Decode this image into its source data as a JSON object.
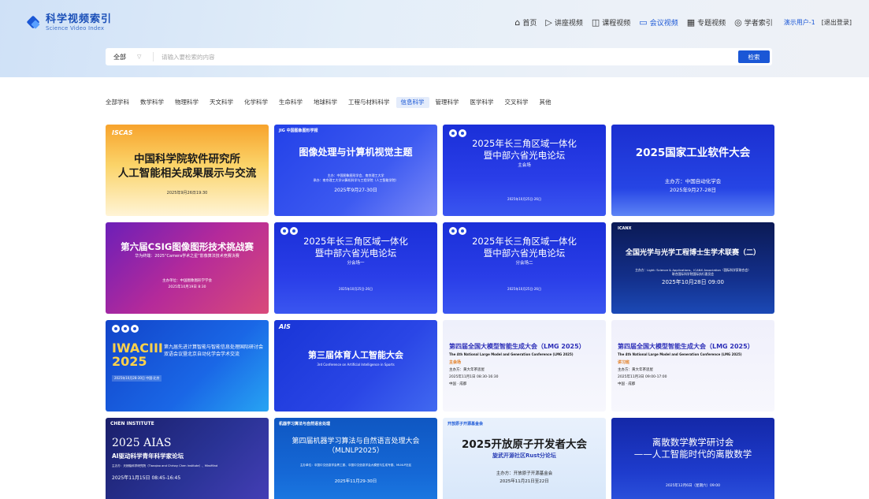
{
  "brand": {
    "name_cn": "科学视频索引",
    "name_en": "Science Video Index",
    "accent": "#1a57d6"
  },
  "nav": {
    "items": [
      {
        "label": "首页",
        "icon": "home-icon"
      },
      {
        "label": "讲座视频",
        "icon": "play-icon"
      },
      {
        "label": "课程视频",
        "icon": "book-icon"
      },
      {
        "label": "会议视频",
        "icon": "monitor-icon",
        "active": true
      },
      {
        "label": "专题视频",
        "icon": "grid-icon"
      },
      {
        "label": "学者索引",
        "icon": "scholar-icon"
      }
    ],
    "user": "演示用户-1",
    "logout": "[退出登录]"
  },
  "search": {
    "scope": "全部",
    "placeholder": "请输入要检索的内容",
    "button": "检索"
  },
  "categories": {
    "items": [
      "全部学科",
      "数学科学",
      "物理科学",
      "天文科学",
      "化学科学",
      "生命科学",
      "地球科学",
      "工程与材料科学",
      "信息科学",
      "管理科学",
      "医学科学",
      "交叉科学",
      "其他"
    ],
    "active": "信息科学"
  },
  "cards": [
    {
      "title": "中国科学院软件研究所\n人工智能相关成果展示与交流",
      "date": "2025年9月26日19:30",
      "tag": "ISCAS"
    },
    {
      "title": "图像处理与计算机视觉主题",
      "org": "主办：中国图象图形学会、南京理工大学\n承办：南京理工大学计算机科学与工程学院（人工智能学院）",
      "date": "2025年9月27-30日",
      "tag": "JIG 中国图象图形学报"
    },
    {
      "title": "2025年长三角区域一体化\n暨中部六省光电论坛",
      "sub": "主会场",
      "date": "2025年10月25日-26日"
    },
    {
      "title": "2025国家工业软件大会",
      "org": "主办方：中国自动化学会",
      "date": "2025年9月27-28日"
    },
    {
      "title": "第六届CSIG图像图形技术挑战赛",
      "sub": "华为终端：2025“Camera学术之星”影像算法技术竞赛决赛",
      "org": "主办单位：中国图象图形学学会",
      "date": "2025年10月19日 8:30"
    },
    {
      "title": "2025年长三角区域一体化\n暨中部六省光电论坛",
      "sub": "分会场一",
      "date": "2025年10月25日-26日"
    },
    {
      "title": "2025年长三角区域一体化\n暨中部六省光电论坛",
      "sub": "分会场二",
      "date": "2025年10月25日-26日"
    },
    {
      "title": "全国光学与光学工程博士生学术联赛（二）",
      "org": "主办方：Light: Science & Applications、ICANX Association（国际科学家联合会）\n联合国际科学院国际执行委员会",
      "date": "2025年10月28日 09:00",
      "tag": "ICANX"
    },
    {
      "title": "IWACIII 2025",
      "sub": "第九届先进计算智能与智能信息处理国际研讨会\n双语会议暨北京自动化学会学术交流",
      "date": "2025年10月28-30日   中国·北京"
    },
    {
      "title": "第三届体育人工智能大会",
      "sub": "3rd Conference on Artificial Intelligence in Sports",
      "tag": "AIS"
    },
    {
      "title": "第四届全国大模型智能生成大会（LMG 2025）",
      "title_en": "The 4th National Large Model and Generation Conference (LMG 2025)",
      "sub": "主会场",
      "org": "主办方：黄大年茶思屋",
      "date": "2025年11月1日 08:30-16:30",
      "place": "中国 · 成都"
    },
    {
      "title": "第四届全国大模型智能生成大会（LMG 2025）",
      "title_en": "The 4th National Large Model and Generation Conference (LMG 2025)",
      "sub": "讲习班",
      "org": "主办方：黄大年茶思屋",
      "date": "2025年11月3日 09:00-17:00",
      "place": "中国 · 成都"
    },
    {
      "title": "2025 AIAS",
      "sub": "AI驱动科学青年科学家论坛",
      "org": "主办方：天桥脑科学研究院（Tianqiao and Chrissy Chen Institute）、MiroMind",
      "date": "2025年11月15日 08:45-16:45",
      "tag": "CHEN INSTITUTE"
    },
    {
      "title": "第四届机器学习算法与自然语言处理大会\n（MLNLP2025）",
      "org": "主办单位：中国中文信息学会青工委、中国中文信息学会大模型与生成专委、MLNLP社区",
      "date": "2025年11月29-30日",
      "tag": "机器学习算法与自然语言处理"
    },
    {
      "title": "2025开放原子开发者大会",
      "sub": "旋武开源社区Rust分论坛",
      "org": "主办方：开放原子开源基金会",
      "date": "2025年11月21日至22日",
      "tag": "开放原子开源基金会"
    },
    {
      "title": "离散数学教学研讨会\n——人工智能时代的离散数学",
      "date": "2025年12月6日（星期六）09:00"
    }
  ]
}
